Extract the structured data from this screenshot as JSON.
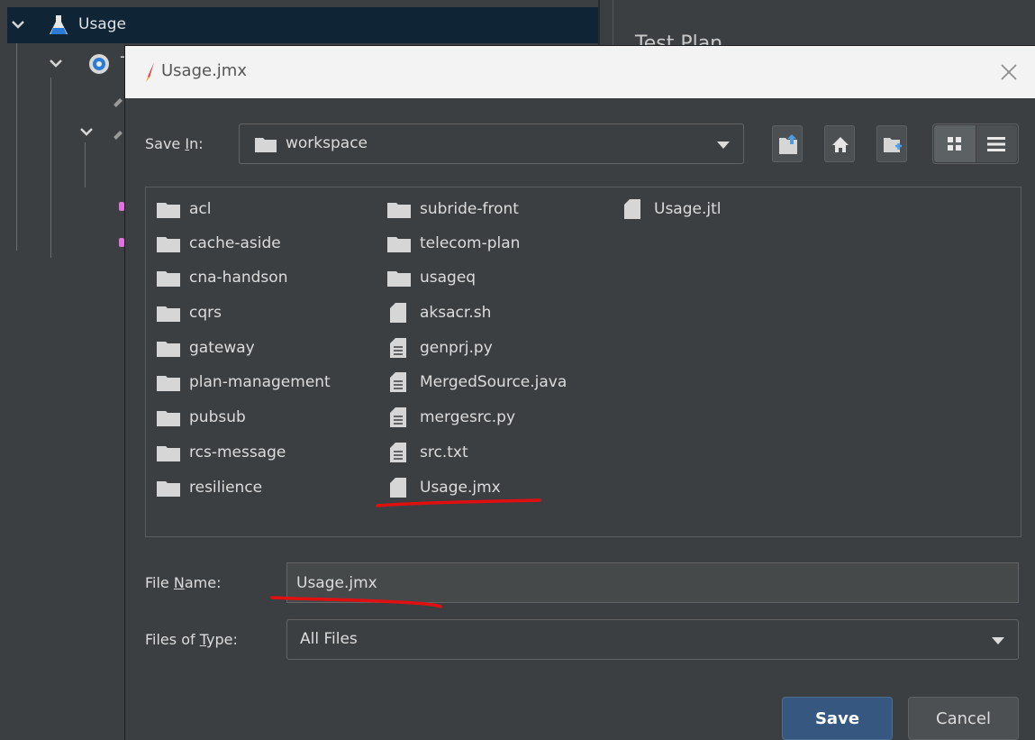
{
  "background": {
    "tree_root_label": "Usage",
    "tree_child_partial": "T",
    "right_panel_title": "Test Plan"
  },
  "dialog": {
    "title": "Usage.jmx",
    "save_in": {
      "label_pre": "Save ",
      "label_mn": "I",
      "label_post": "n:",
      "value": "workspace"
    },
    "toolbar": {
      "up_folder": "up-folder-icon",
      "home": "home-icon",
      "new_folder": "new-folder-icon",
      "list_view": "list-view-icon",
      "details_view": "details-view-icon"
    },
    "files": {
      "column1": [
        {
          "name": "acl",
          "kind": "folder"
        },
        {
          "name": "cache-aside",
          "kind": "folder"
        },
        {
          "name": "cna-handson",
          "kind": "folder"
        },
        {
          "name": "cqrs",
          "kind": "folder"
        },
        {
          "name": "gateway",
          "kind": "folder"
        },
        {
          "name": "plan-management",
          "kind": "folder"
        },
        {
          "name": "pubsub",
          "kind": "folder"
        },
        {
          "name": "rcs-message",
          "kind": "folder"
        },
        {
          "name": "resilience",
          "kind": "folder"
        }
      ],
      "column2": [
        {
          "name": "subride-front",
          "kind": "folder"
        },
        {
          "name": "telecom-plan",
          "kind": "folder"
        },
        {
          "name": "usageq",
          "kind": "folder"
        },
        {
          "name": "aksacr.sh",
          "kind": "file"
        },
        {
          "name": "genprj.py",
          "kind": "text-file"
        },
        {
          "name": "MergedSource.java",
          "kind": "text-file"
        },
        {
          "name": "mergesrc.py",
          "kind": "text-file"
        },
        {
          "name": "src.txt",
          "kind": "text-file"
        },
        {
          "name": "Usage.jmx",
          "kind": "file"
        }
      ],
      "column3": [
        {
          "name": "Usage.jtl",
          "kind": "file"
        }
      ]
    },
    "file_name": {
      "label_pre": "File ",
      "label_mn": "N",
      "label_post": "ame:",
      "value": "Usage.jmx"
    },
    "file_type": {
      "label_pre": "Files of ",
      "label_mn": "T",
      "label_post": "ype:",
      "value": "All Files"
    },
    "save_label": "Save",
    "cancel_label": "Cancel"
  },
  "colors": {
    "annotation": "#e01010",
    "primary_button": "#365880",
    "dialog_bg": "#3c3f41",
    "title_bar": "#f3f3f3"
  }
}
